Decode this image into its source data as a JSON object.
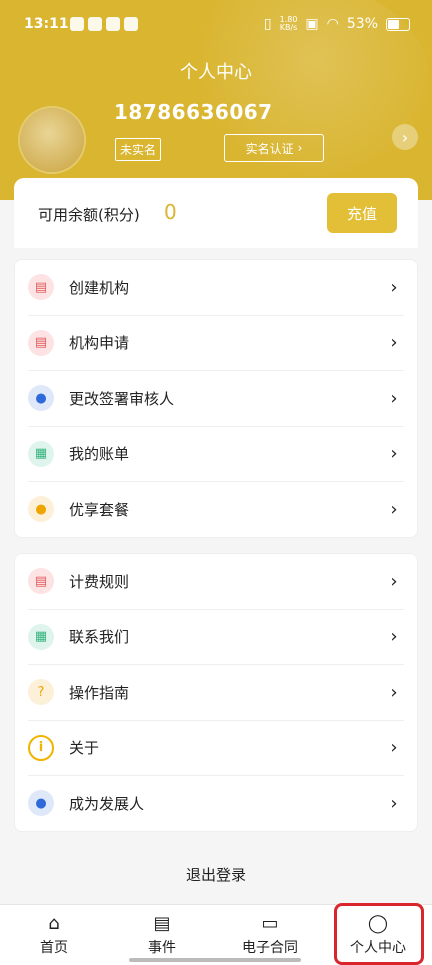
{
  "status_bar": {
    "time": "13:11",
    "speed_top": "1.80",
    "speed_bottom": "KB/s",
    "battery": "53%"
  },
  "header": {
    "title": "个人中心",
    "phone": "18786636067",
    "badge": "未实名",
    "verify_button": "实名认证"
  },
  "balance": {
    "label": "可用余额(积分)",
    "value": "0",
    "recharge_label": "充值"
  },
  "menu_group_1": [
    {
      "label": "创建机构",
      "icon": "id-card-icon"
    },
    {
      "label": "机构申请",
      "icon": "id-card-icon"
    },
    {
      "label": "更改签署审核人",
      "icon": "user-icon"
    },
    {
      "label": "我的账单",
      "icon": "bill-icon"
    },
    {
      "label": "优享套餐",
      "icon": "location-pin-icon"
    }
  ],
  "menu_group_2": [
    {
      "label": "计费规则",
      "icon": "id-card-icon"
    },
    {
      "label": "联系我们",
      "icon": "contact-icon"
    },
    {
      "label": "操作指南",
      "icon": "question-icon"
    },
    {
      "label": "关于",
      "icon": "info-icon"
    },
    {
      "label": "成为发展人",
      "icon": "user-icon"
    }
  ],
  "logout_label": "退出登录",
  "tabs": [
    {
      "label": "首页",
      "icon": "home-icon"
    },
    {
      "label": "事件",
      "icon": "document-icon"
    },
    {
      "label": "电子合同",
      "icon": "truck-icon"
    },
    {
      "label": "个人中心",
      "icon": "person-icon",
      "active": true
    }
  ],
  "colors": {
    "accent": "#d9b530",
    "highlight_outline": "#d9262d"
  }
}
